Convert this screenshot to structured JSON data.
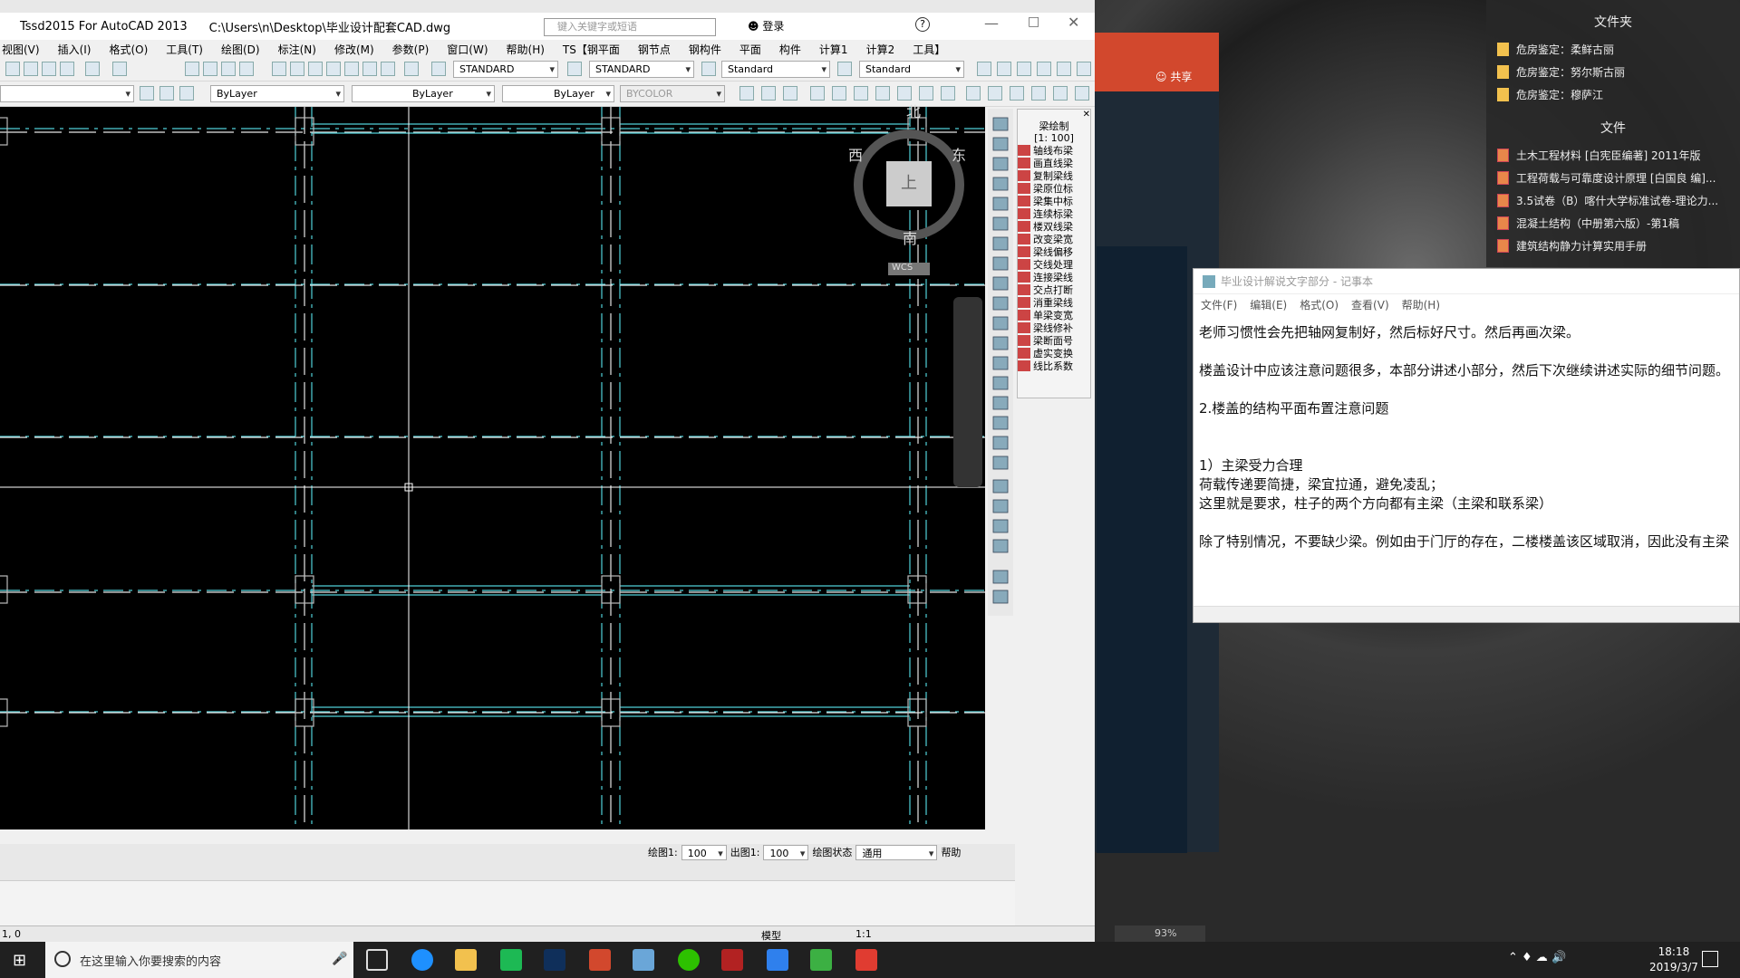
{
  "cad": {
    "app_title": "Tssd2015 For AutoCAD 2013",
    "file_path": "C:\\Users\\n\\Desktop\\毕业设计配套CAD.dwg",
    "search_placeholder": "键入关键字或短语",
    "login": "登录",
    "menu": [
      "视图(V)",
      "插入(I)",
      "格式(O)",
      "工具(T)",
      "绘图(D)",
      "标注(N)",
      "修改(M)",
      "参数(P)",
      "窗口(W)",
      "帮助(H)",
      "TS【钢平面",
      "钢节点",
      "钢构件",
      "平面",
      "构件",
      "计算1",
      "计算2",
      "工具】"
    ],
    "styles": [
      "STANDARD",
      "STANDARD",
      "Standard",
      "Standard"
    ],
    "layer": "ByLayer",
    "linetype": "ByLayer",
    "lineweight": "ByLayer",
    "color": "BYCOLOR",
    "compass": {
      "north": "北",
      "south": "南",
      "east": "东",
      "west": "西",
      "top": "上",
      "wcs": "WCS"
    },
    "drawbar": {
      "scale_label": "绘图1:",
      "scale_value": "100",
      "out_label": "出图1:",
      "out_value": "100",
      "state_label": "绘图状态",
      "state_value": "通用",
      "help": "帮助"
    },
    "status_coords": "1, 0",
    "status_model": "模型",
    "status_scale": "1:1",
    "zoom": "93%"
  },
  "beam_panel": {
    "title": "梁绘制",
    "scale": "[1: 100]",
    "items": [
      "轴线布梁",
      "画直线梁",
      "复制梁线",
      "梁原位标",
      "梁集中标",
      "连续标梁",
      "楼双线梁",
      "改变梁宽",
      "梁线偏移",
      "交线处理",
      "连接梁线",
      "交点打断",
      "消重梁线",
      "单梁变宽",
      "梁线修补",
      "梁断面号",
      "虚实变换",
      "线比系数"
    ]
  },
  "ppt": {
    "share": "共享"
  },
  "files_panel": {
    "header1": "文件夹",
    "folders": [
      "危房鉴定：柔鲜古丽",
      "危房鉴定：努尔斯古丽",
      "危房鉴定：穆萨江"
    ],
    "header2": "文件",
    "files": [
      "土木工程材料 [白宪臣编著] 2011年版",
      "工程荷载与可靠度设计原理 [白国良 编]...",
      "3.5试卷（B）喀什大学标准试卷-理论力...",
      "混凝土结构（中册第六版）-第1稿",
      "建筑结构静力计算实用手册"
    ]
  },
  "notepad": {
    "title": "毕业设计解说文字部分 - 记事本",
    "menu": [
      "文件(F)",
      "编辑(E)",
      "格式(O)",
      "查看(V)",
      "帮助(H)"
    ],
    "lines": [
      "老师习惯性会先把轴网复制好，然后标好尺寸。然后再画次梁。",
      "",
      "楼盖设计中应该注意问题很多，本部分讲述小部分，然后下次继续讲述实际的细节问题。",
      "",
      "2.楼盖的结构平面布置注意问题",
      "",
      "",
      "1）主梁受力合理",
      "荷载传递要简捷，梁宜拉通，避免凌乱；",
      "这里就是要求，柱子的两个方向都有主梁（主梁和联系梁）",
      "",
      "除了特别情况，不要缺少梁。例如由于门厅的存在，二楼楼盖该区域取消，因此没有主梁"
    ]
  },
  "taskbar": {
    "search_placeholder": "在这里输入你要搜索的内容",
    "time": "18:18",
    "date": "2019/3/7"
  },
  "colors": {
    "accent_orange": "#d2482d",
    "cad_cyan": "#4fd0d8"
  }
}
